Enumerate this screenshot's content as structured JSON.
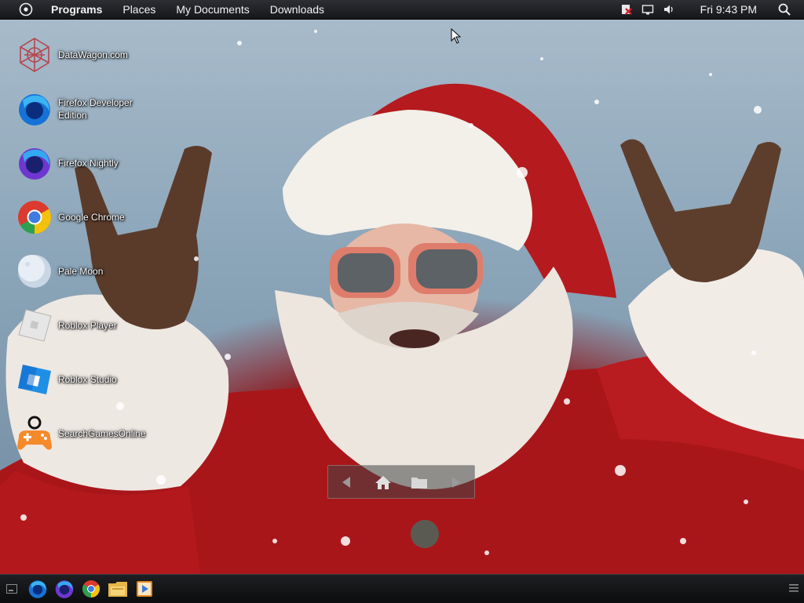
{
  "top_panel": {
    "menu": [
      "Programs",
      "Places",
      "My Documents",
      "Downloads"
    ],
    "clock": "Fri 9:43 PM",
    "tray_icons": [
      "network-error-icon",
      "display-icon",
      "volume-icon",
      "search-icon"
    ]
  },
  "desktop": {
    "icons": [
      {
        "label": "DataWagon.com",
        "icon": "datawagon-icon"
      },
      {
        "label": "Firefox Developer Edition",
        "icon": "firefox-developer-icon"
      },
      {
        "label": "Firefox Nightly",
        "icon": "firefox-nightly-icon"
      },
      {
        "label": "Google Chrome",
        "icon": "chrome-icon"
      },
      {
        "label": "Pale Moon",
        "icon": "pale-moon-icon"
      },
      {
        "label": "Roblox Player",
        "icon": "roblox-player-icon"
      },
      {
        "label": "Roblox Studio",
        "icon": "roblox-studio-icon"
      },
      {
        "label": "SearchGamesOnline",
        "icon": "game-controller-icon"
      }
    ],
    "wallpaper": "santa-claus-sunglasses"
  },
  "nav_widget": {
    "buttons": [
      "back-arrow-icon",
      "home-icon",
      "folder-icon",
      "forward-arrow-icon"
    ]
  },
  "taskbar": {
    "items": [
      "show-desktop-icon",
      "firefox-developer-icon",
      "firefox-nightly-icon",
      "chrome-icon",
      "file-manager-icon",
      "media-player-icon",
      "menu-lines-icon"
    ]
  },
  "colors": {
    "panel": "#15171a",
    "santa_red": "#b3191c",
    "sky": "#8aa4b8"
  }
}
